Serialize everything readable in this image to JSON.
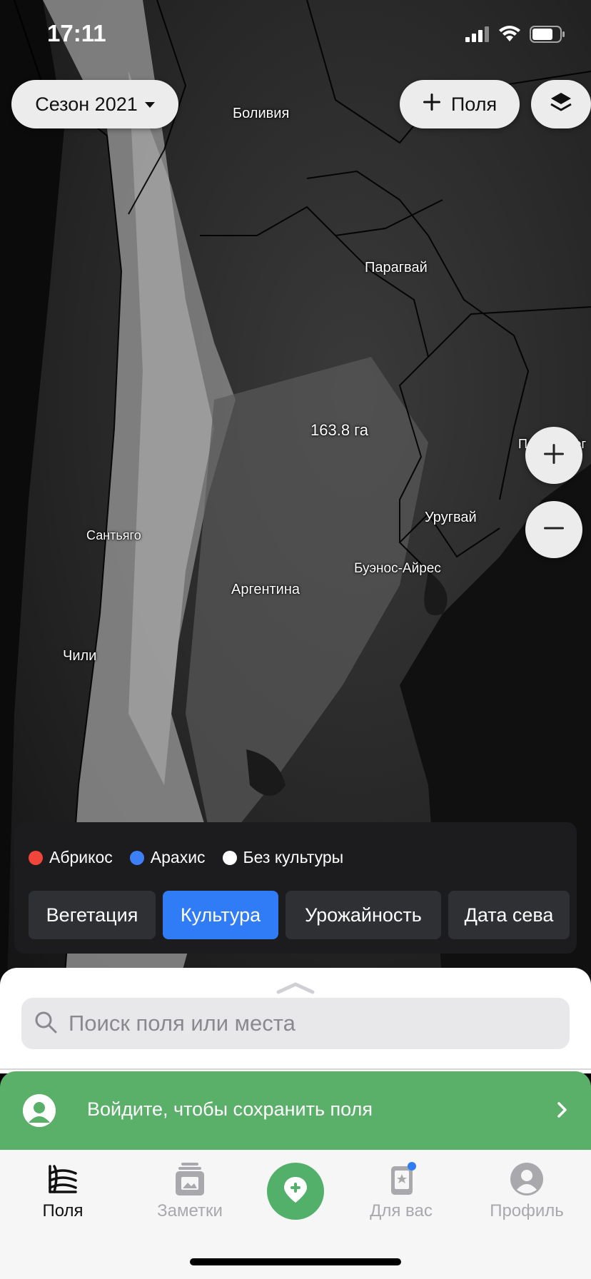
{
  "status_bar": {
    "time": "17:11"
  },
  "top_bar": {
    "season_label": "Сезон 2021",
    "add_fields_label": "Поля"
  },
  "map": {
    "labels": {
      "bolivia": "Боливия",
      "paraguay": "Парагвай",
      "field_area": "163.8 га",
      "porto_alegre": "Порту-Алег",
      "uruguay": "Уругвай",
      "santiago": "Сантьяго",
      "buenos_aires": "Буэнос-Айрес",
      "argentina": "Аргентина",
      "chile": "Чили"
    }
  },
  "crop_panel": {
    "legend": [
      {
        "label": "Абрикос",
        "color": "#f0453a"
      },
      {
        "label": "Арахис",
        "color": "#3d7ff5"
      },
      {
        "label": "Без культуры",
        "color": "#ffffff"
      }
    ],
    "tabs": [
      {
        "label": "Вегетация",
        "active": false
      },
      {
        "label": "Культура",
        "active": true
      },
      {
        "label": "Урожайность",
        "active": false
      },
      {
        "label": "Дата сева",
        "active": false
      }
    ]
  },
  "search": {
    "placeholder": "Поиск поля или места"
  },
  "login_banner": {
    "text": "Войдите, чтобы сохранить поля",
    "color": "#5aaf69"
  },
  "tab_bar": {
    "tabs": [
      {
        "label": "Поля",
        "icon": "fields-icon",
        "active": true
      },
      {
        "label": "Заметки",
        "icon": "notes-icon",
        "active": false
      },
      {
        "label": "Для вас",
        "icon": "for-you-icon",
        "active": false,
        "badge": true
      },
      {
        "label": "Профиль",
        "icon": "profile-icon",
        "active": false
      }
    ],
    "accent_color": "#53b06a"
  }
}
